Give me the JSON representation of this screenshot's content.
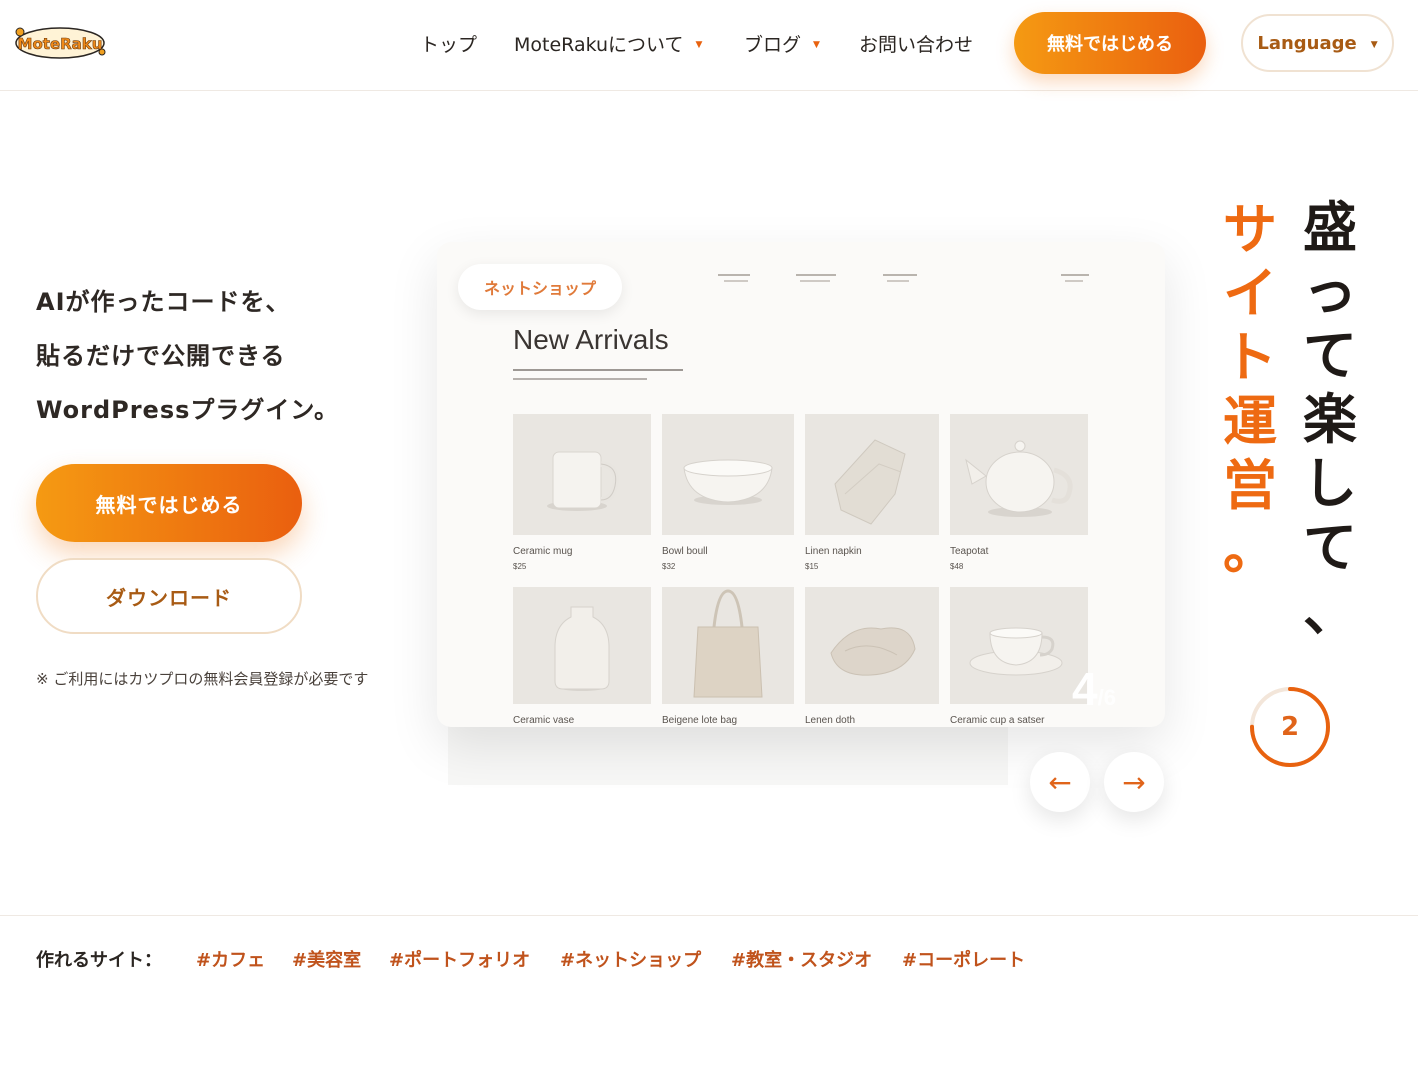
{
  "header": {
    "logo_text": "MoteRaku",
    "nav": [
      {
        "label": "トップ",
        "has_dropdown": false
      },
      {
        "label": "MoteRakuについて",
        "has_dropdown": true
      },
      {
        "label": "ブログ",
        "has_dropdown": true
      },
      {
        "label": "お問い合わせ",
        "has_dropdown": false
      }
    ],
    "cta_label": "無料ではじめる",
    "language_label": "Language"
  },
  "hero": {
    "lead_lines": [
      "AIが作ったコードを、",
      "貼るだけで公開できる",
      "WordPressプラグイン。"
    ],
    "primary_button": "無料ではじめる",
    "secondary_button": "ダウンロード",
    "note": "※ ご利用にはカツプロの無料会員登録が必要です",
    "headline_dark": "盛って楽して、",
    "headline_orange": "サイト運営。"
  },
  "slider": {
    "chip_label": "ネットショップ",
    "mock_title": "New Arrivals",
    "products": [
      {
        "name": "Ceramic mug",
        "price": "$25"
      },
      {
        "name": "Bowl boull",
        "price": "$32"
      },
      {
        "name": "Linen napkin",
        "price": "$15"
      },
      {
        "name": "Teapotat",
        "price": "$48"
      },
      {
        "name": "Ceramic vase",
        "price": ""
      },
      {
        "name": "Beigene lote bag",
        "price": ""
      },
      {
        "name": "Lenen doth",
        "price": ""
      },
      {
        "name": "Ceramic cup a satser",
        "price": ""
      }
    ],
    "counter_current": "4",
    "counter_total": "/6",
    "prev_label": "←",
    "next_label": "→",
    "progress_number": "2",
    "progress_fraction": 0.75
  },
  "tags": {
    "label": "作れるサイト：",
    "items": [
      "#カフェ",
      "#美容室",
      "#ポートフォリオ",
      "#ネットショップ",
      "#教室・スタジオ",
      "#コーポレート"
    ]
  },
  "colors": {
    "accent": "#ea5f0f",
    "accent_light": "#f59a12",
    "tag_text": "#c0531c",
    "outline_text": "#a85b14"
  }
}
